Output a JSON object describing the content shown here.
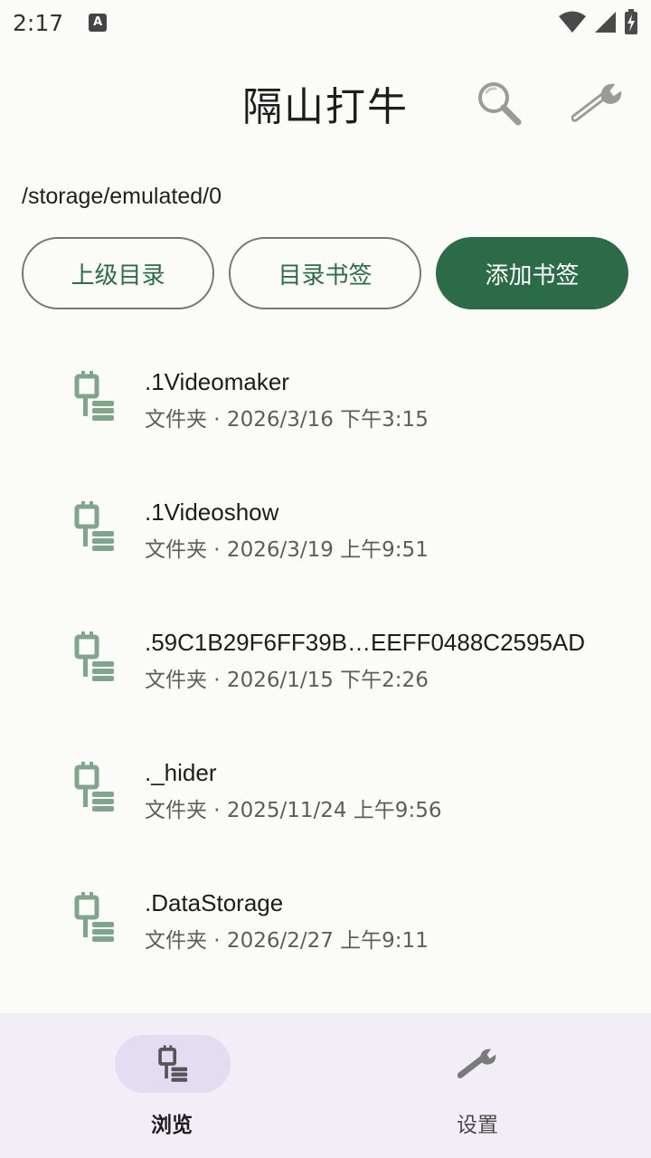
{
  "status_bar": {
    "time": "2:17",
    "notification_icon": "A"
  },
  "app_bar": {
    "title": "隔山打牛",
    "search_icon": "search-icon",
    "tools_icon": "wrench-icon"
  },
  "path": "/storage/emulated/0",
  "buttons": {
    "parent_dir": "上级目录",
    "dir_bookmarks": "目录书签",
    "add_bookmark": "添加书签"
  },
  "colors": {
    "primary": "#2c6b47",
    "outline": "#727970",
    "folder_icon": "#7fa68c",
    "nav_bg": "#f1eef7",
    "nav_pill": "#e4dcf3"
  },
  "files": [
    {
      "name": ".1Videomaker",
      "meta": "文件夹 · 2026/3/16 下午3:15"
    },
    {
      "name": ".1Videoshow",
      "meta": "文件夹 · 2026/3/19 上午9:51"
    },
    {
      "name": ".59C1B29F6FF39B…EEFF0488C2595AD",
      "meta": "文件夹 · 2026/1/15 下午2:26"
    },
    {
      "name": "._hider",
      "meta": "文件夹 · 2025/11/24 上午9:56"
    },
    {
      "name": ".DataStorage",
      "meta": "文件夹 · 2026/2/27 上午9:11"
    }
  ],
  "bottom_nav": {
    "browse": "浏览",
    "settings": "设置"
  }
}
